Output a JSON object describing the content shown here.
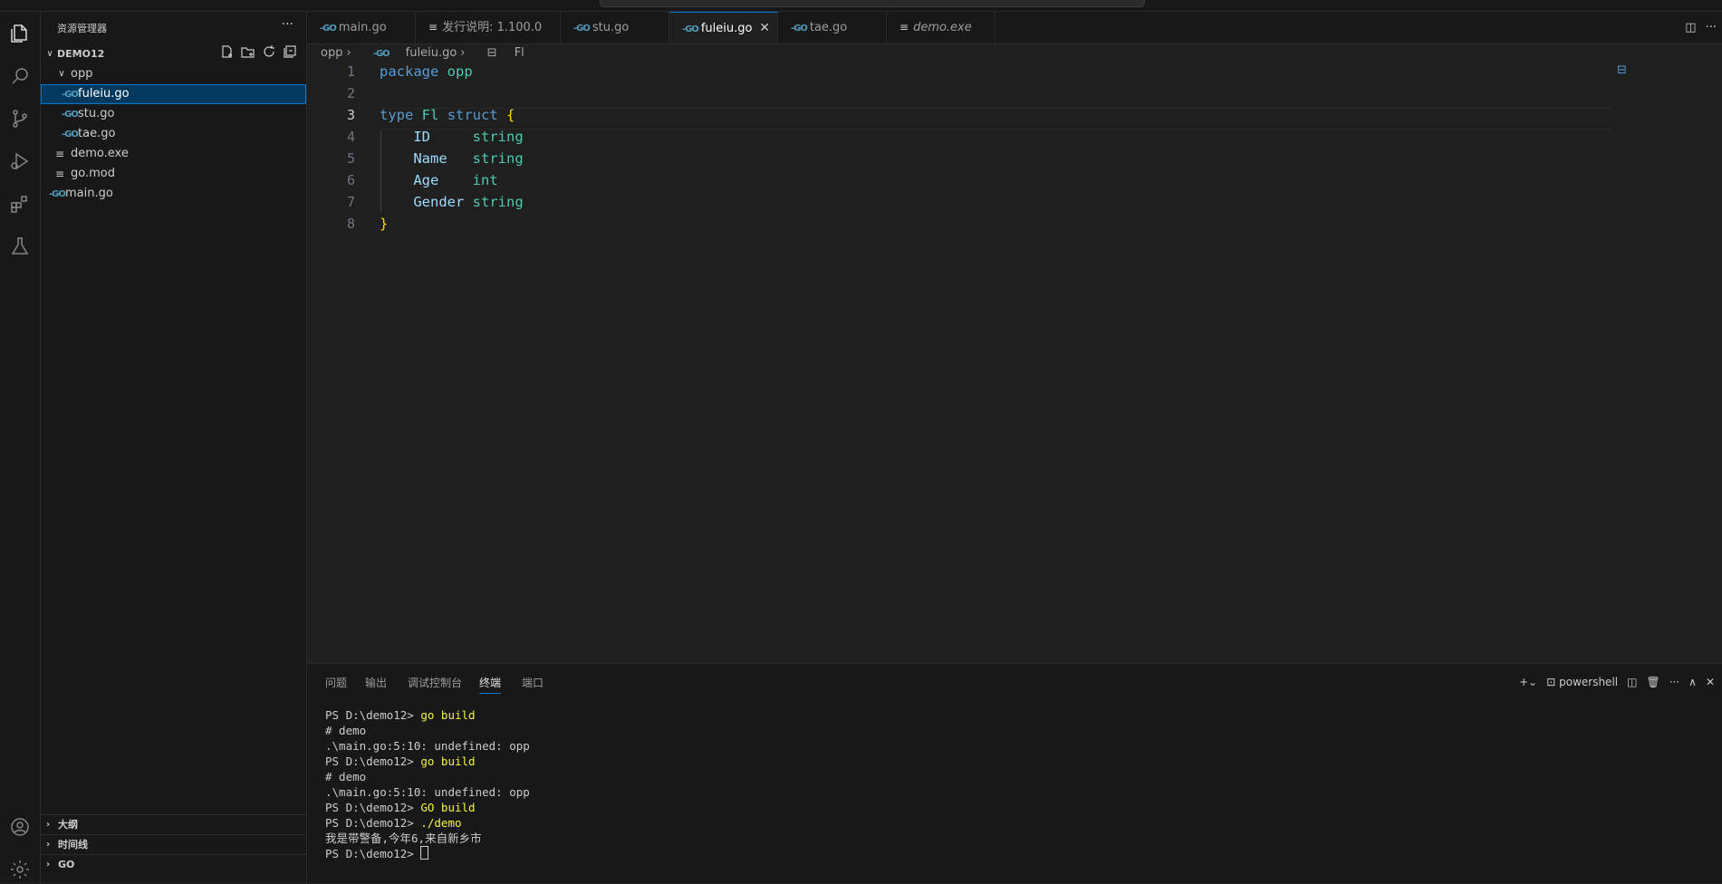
{
  "sidebar": {
    "title": "资源管理器",
    "more_label": "···",
    "root_folder": "DEMO12",
    "tree": [
      {
        "label": "opp",
        "kind": "folder"
      },
      {
        "label": "fuleiu.go",
        "kind": "go"
      },
      {
        "label": "stu.go",
        "kind": "go"
      },
      {
        "label": "tae.go",
        "kind": "go"
      },
      {
        "label": "demo.exe",
        "kind": "file"
      },
      {
        "label": "go.mod",
        "kind": "file"
      },
      {
        "label": "main.go",
        "kind": "go"
      }
    ],
    "sections": [
      {
        "label": "大纲"
      },
      {
        "label": "时间线"
      },
      {
        "label": "GO"
      }
    ]
  },
  "tabs": [
    {
      "label": "main.go",
      "icon": "go-icon"
    },
    {
      "label": "发行说明: 1.100.0",
      "icon": "file-icon"
    },
    {
      "label": "stu.go",
      "icon": "go-icon"
    },
    {
      "label": "fuleiu.go",
      "icon": "go-icon",
      "active": true
    },
    {
      "label": "tae.go",
      "icon": "go-icon"
    },
    {
      "label": "demo.exe",
      "icon": "file-icon"
    }
  ],
  "breadcrumb": {
    "folder": "opp",
    "file": "fuleiu.go",
    "symbol": "Fl"
  },
  "editor": {
    "line_numbers": [
      "1",
      "2",
      "3",
      "4",
      "5",
      "6",
      "7",
      "8"
    ],
    "current_line": "3",
    "code": {
      "pkg_kw": "package",
      "pkg_name": "opp",
      "type_kw": "type",
      "type_name": "Fl",
      "struct_kw": "struct",
      "open_brace": "{",
      "close_brace": "}",
      "fields": [
        {
          "name": "ID",
          "type": "string"
        },
        {
          "name": "Name",
          "type": "string"
        },
        {
          "name": "Age",
          "type": "int"
        },
        {
          "name": "Gender",
          "type": "string"
        }
      ]
    }
  },
  "panel": {
    "tabs": [
      "问题",
      "输出",
      "调试控制台",
      "终端",
      "端口"
    ],
    "active_tab": "终端",
    "shell_label": "powershell",
    "terminal_lines": [
      {
        "prompt": "PS D:\\demo12> ",
        "cmd": "go build"
      },
      {
        "text": "# demo"
      },
      {
        "text": ".\\main.go:5:10: undefined: opp"
      },
      {
        "prompt": "PS D:\\demo12> ",
        "cmd": "go build"
      },
      {
        "text": "# demo"
      },
      {
        "text": ".\\main.go:5:10: undefined: opp"
      },
      {
        "prompt": "PS D:\\demo12> ",
        "cmd": "GO build"
      },
      {
        "prompt": "PS D:\\demo12> ",
        "cmd": "./demo"
      },
      {
        "text": "我是带警备,今年6,来自新乡市"
      },
      {
        "prompt": "PS D:\\demo12> ",
        "cmd": ""
      }
    ]
  }
}
